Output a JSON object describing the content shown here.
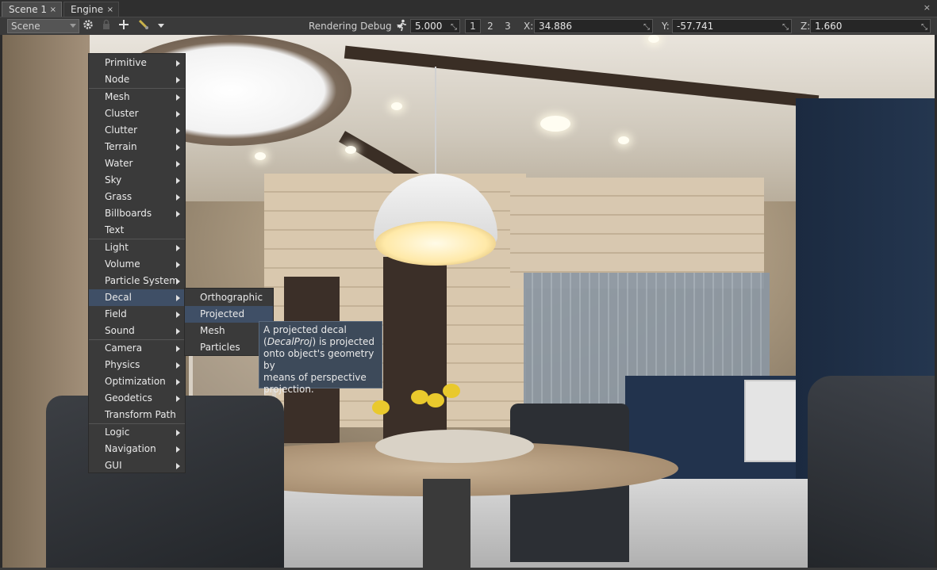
{
  "tabs": [
    {
      "label": "Scene 1",
      "close": "×"
    },
    {
      "label": "Engine",
      "close": "×"
    }
  ],
  "window_close": "×",
  "toolbar": {
    "camera_select": "Scene Camera",
    "rendering_debug": "Rendering Debug",
    "speed_value": "5.000",
    "view_buttons": [
      "1",
      "2",
      "3"
    ],
    "x_label": "X:",
    "x_value": "34.886",
    "y_label": "Y:",
    "y_value": "-57.741",
    "z_label": "Z:",
    "z_value": "1.660",
    "icons": [
      "gear-icon",
      "lock-icon",
      "move-icon",
      "snap-icon",
      "dropdown-icon",
      "speed-icon"
    ]
  },
  "menu": {
    "items": [
      {
        "label": "Primitive",
        "has_sub": true
      },
      {
        "label": "Node",
        "has_sub": true
      },
      {
        "label": "Mesh",
        "has_sub": true
      },
      {
        "label": "Cluster",
        "has_sub": true
      },
      {
        "label": "Clutter",
        "has_sub": true
      },
      {
        "label": "Terrain",
        "has_sub": true
      },
      {
        "label": "Water",
        "has_sub": true
      },
      {
        "label": "Sky",
        "has_sub": true
      },
      {
        "label": "Grass",
        "has_sub": true
      },
      {
        "label": "Billboards",
        "has_sub": true
      },
      {
        "label": "Text",
        "has_sub": false
      },
      {
        "label": "Light",
        "has_sub": true
      },
      {
        "label": "Volume",
        "has_sub": true
      },
      {
        "label": "Particle System",
        "has_sub": true
      },
      {
        "label": "Decal",
        "has_sub": true,
        "highlighted": true
      },
      {
        "label": "Field",
        "has_sub": true
      },
      {
        "label": "Sound",
        "has_sub": true
      },
      {
        "label": "Camera",
        "has_sub": true
      },
      {
        "label": "Physics",
        "has_sub": true
      },
      {
        "label": "Optimization",
        "has_sub": true
      },
      {
        "label": "Geodetics",
        "has_sub": true
      },
      {
        "label": "Transform Path",
        "has_sub": false
      },
      {
        "label": "Logic",
        "has_sub": true
      },
      {
        "label": "Navigation",
        "has_sub": true
      },
      {
        "label": "GUI",
        "has_sub": true
      }
    ]
  },
  "submenu": {
    "items": [
      {
        "label": "Orthographic"
      },
      {
        "label": "Projected",
        "highlighted": true
      },
      {
        "label": "Mesh"
      },
      {
        "label": "Particles"
      }
    ]
  },
  "tooltip": {
    "line1": "A projected decal",
    "line2_open": "(",
    "line2_italic": "DecalProj",
    "line2_rest": ") is projected",
    "line3": "onto object's geometry by",
    "line4": "means of perspective",
    "line5": "projection."
  },
  "colors": {
    "highlight": "#3f4f66",
    "menu_bg": "#3a3a3a",
    "tooltip_bg": "#3d4a5a"
  }
}
